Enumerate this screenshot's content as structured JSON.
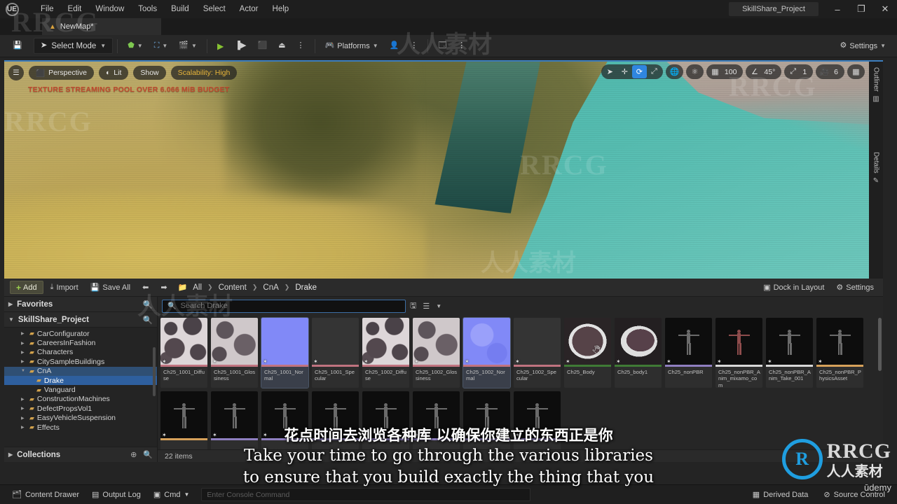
{
  "titlebar": {
    "logo": "ue-logo",
    "menus": [
      "File",
      "Edit",
      "Window",
      "Tools",
      "Build",
      "Select",
      "Actor",
      "Help"
    ],
    "project_title": "SkillShare_Project",
    "minimize": "–",
    "maximize": "❐",
    "close": "✕"
  },
  "tabbar": {
    "map_tab": "NewMap*"
  },
  "toolbar": {
    "save_icon": "save-icon",
    "select_mode": "Select Mode",
    "add_icon": "add-actor-icon",
    "blueprint_icon": "blueprints-icon",
    "cinematics_icon": "cinematics-icon",
    "play_icon": "play-icon",
    "skip_icon": "skip-icon",
    "stop_icon": "stop-icon",
    "eject_icon": "eject-icon",
    "platforms": "Platforms",
    "settings": "Settings"
  },
  "viewport": {
    "menu_icon": "viewport-menu-icon",
    "perspective": "Perspective",
    "lit": "Lit",
    "show": "Show",
    "scalability": "Scalability: High",
    "warning": "TEXTURE STREAMING POOL OVER 6.066 MiB BUDGET",
    "transform_tools": [
      {
        "name": "select-tool-icon",
        "glyph": "➤",
        "active": false
      },
      {
        "name": "move-tool-icon",
        "glyph": "✛",
        "active": false
      },
      {
        "name": "rotate-tool-icon",
        "glyph": "⟳",
        "active": true
      },
      {
        "name": "scale-tool-icon",
        "glyph": "⤢",
        "active": false
      }
    ],
    "coord_icon": "world-coordinate-icon",
    "surface_snap_icon": "surface-snap-icon",
    "grid_snap_icon": "grid-snap-icon",
    "grid_value": "100",
    "angle_snap_icon": "angle-snap-icon",
    "angle_value": "45°",
    "scale_snap_icon": "scale-snap-icon",
    "scale_value": "1",
    "camera_speed_icon": "camera-speed-icon",
    "camera_speed_value": "6",
    "layout_icon": "viewport-layout-icon",
    "side_tabs": [
      "Outliner",
      "Details"
    ],
    "colors": {
      "sand": "#c6b273",
      "water": "#56bdb1",
      "rock": "#5b5c30",
      "warning": "#c24a2e",
      "accent": "#2f86e0"
    }
  },
  "content_browser": {
    "add_label": "Add",
    "import_label": "Import",
    "save_all_label": "Save All",
    "nav_back_icon": "nav-back-icon",
    "nav_forward_icon": "nav-forward-icon",
    "folder_icon": "folder-icon",
    "breadcrumbs": [
      "All",
      "Content",
      "CnA",
      "Drake"
    ],
    "dock_in_layout": "Dock in Layout",
    "settings": "Settings",
    "favorites_label": "Favorites",
    "project_label": "SkillShare_Project",
    "collections_label": "Collections",
    "search_placeholder": "Search Drake",
    "search_value": "",
    "save_search_icon": "save-search-icon",
    "filter_icon": "filter-icon",
    "item_count": "22 items",
    "tree": [
      {
        "label": "CarConfigurator",
        "depth": 1,
        "expandable": true,
        "state": "normal"
      },
      {
        "label": "CareersInFashion",
        "depth": 1,
        "expandable": true,
        "state": "normal"
      },
      {
        "label": "Characters",
        "depth": 1,
        "expandable": true,
        "state": "normal"
      },
      {
        "label": "CitySampleBuildings",
        "depth": 1,
        "expandable": true,
        "state": "normal"
      },
      {
        "label": "CnA",
        "depth": 1,
        "expandable": true,
        "state": "open"
      },
      {
        "label": "Drake",
        "depth": 2,
        "expandable": false,
        "state": "selected"
      },
      {
        "label": "Vanguard",
        "depth": 2,
        "expandable": false,
        "state": "normal"
      },
      {
        "label": "ConstructionMachines",
        "depth": 1,
        "expandable": true,
        "state": "normal"
      },
      {
        "label": "DefectPropsVol1",
        "depth": 1,
        "expandable": true,
        "state": "normal"
      },
      {
        "label": "EasyVehicleSuspension",
        "depth": 1,
        "expandable": true,
        "state": "normal"
      },
      {
        "label": "Effects",
        "depth": 1,
        "expandable": true,
        "state": "normal"
      }
    ],
    "assets": [
      {
        "name": "Ch25_1001_Diffuse",
        "thumb": "tx-diff",
        "bar": "#c0737f",
        "selected": false
      },
      {
        "name": "Ch25_1001_Glossiness",
        "thumb": "tx-gloss",
        "bar": "#c0737f",
        "selected": false
      },
      {
        "name": "Ch25_1001_Normal",
        "thumb": "tx-norm",
        "bar": "#c0737f",
        "selected": true
      },
      {
        "name": "Ch25_1001_Specular",
        "thumb": "tx-spec",
        "bar": "#c0737f",
        "selected": false
      },
      {
        "name": "Ch25_1002_Diffuse",
        "thumb": "tx-diff",
        "bar": "#c0737f",
        "selected": false
      },
      {
        "name": "Ch25_1002_Glossiness",
        "thumb": "tx-gloss",
        "bar": "#c0737f",
        "selected": false
      },
      {
        "name": "Ch25_1002_Normal",
        "thumb": "tx-norm2",
        "bar": "#c0737f",
        "selected": true
      },
      {
        "name": "Ch25_1002_Specular",
        "thumb": "tx-spec",
        "bar": "#c0737f",
        "selected": false
      },
      {
        "name": "Ch25_Body",
        "thumb": "tx-body",
        "bar": "#3f7a35",
        "selected": false,
        "hover": true
      },
      {
        "name": "Ch25_body1",
        "thumb": "tx-body2",
        "bar": "#3f7a35",
        "selected": false
      },
      {
        "name": "Ch25_nonPBR",
        "thumb": "fig-white",
        "bar": "#8f7fc0",
        "selected": false
      },
      {
        "name": "Ch25_nonPBR_Anim_mixamo_com",
        "thumb": "fig-red",
        "bar": "#d8d8d8",
        "selected": false
      },
      {
        "name": "Ch25_nonPBR_Anim_Take_001",
        "thumb": "fig-white",
        "bar": "#d8d8d8",
        "selected": false
      },
      {
        "name": "Ch25_nonPBR_PhysicsAsset",
        "thumb": "fig-white",
        "bar": "#d6a15a",
        "selected": false
      },
      {
        "name": "",
        "thumb": "fig-white",
        "bar": "#d6a15a",
        "selected": false
      },
      {
        "name": "",
        "thumb": "fig-white",
        "bar": "#8f7fc0",
        "selected": false
      },
      {
        "name": "",
        "thumb": "fig-white",
        "bar": "#8f7fc0",
        "selected": false
      },
      {
        "name": "",
        "thumb": "fig-white",
        "bar": "#8f7fc0",
        "selected": false
      },
      {
        "name": "",
        "thumb": "fig-white",
        "bar": "#8f7fc0",
        "selected": false
      },
      {
        "name": "",
        "thumb": "fig-white",
        "bar": "#8f7fc0",
        "selected": false
      },
      {
        "name": "",
        "thumb": "fig-white",
        "bar": "#8f7fc0",
        "selected": false
      },
      {
        "name": "",
        "thumb": "fig-white",
        "bar": "#8f7fc0",
        "selected": false
      }
    ]
  },
  "statusbar": {
    "content_drawer": "Content Drawer",
    "output_log": "Output Log",
    "cmd": "Cmd",
    "console_placeholder": "Enter Console Command",
    "derived_data": "Derived Data",
    "source_control": "Source Control"
  },
  "subtitles": {
    "chinese": "花点时间去浏览各种库 以确保你建立的东西正是你",
    "english_line1": "Take your time to go through the various libraries",
    "english_line2": "to ensure that you build exactly the thing that you"
  },
  "watermarks": {
    "rrcg": "RRCG",
    "chinese": "人人素材",
    "udemy": "ūdemy",
    "mark": "R"
  }
}
